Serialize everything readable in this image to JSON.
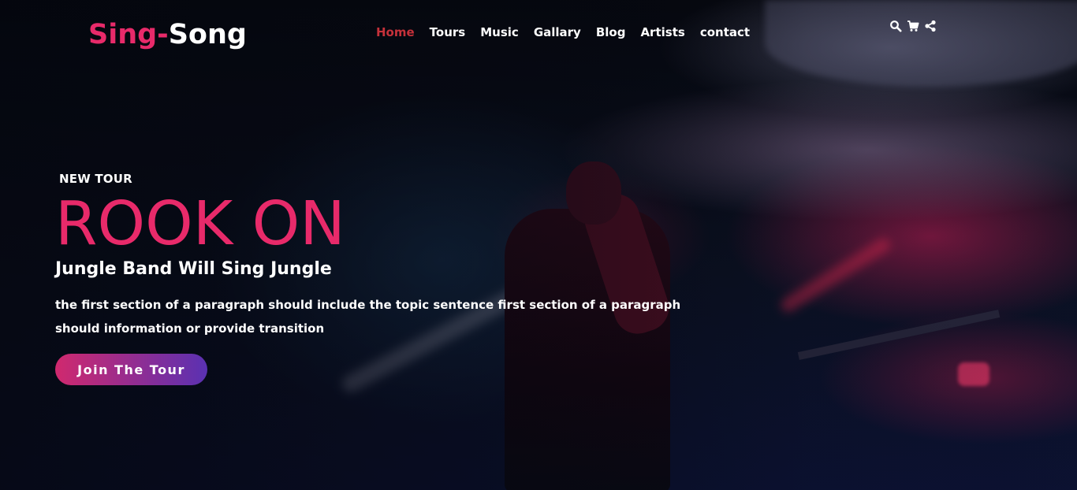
{
  "brand": {
    "part1": "Sing-",
    "part2": "Song",
    "accent": "#e82a6a"
  },
  "nav": {
    "items": [
      {
        "label": "Home",
        "active": true
      },
      {
        "label": "Tours",
        "active": false
      },
      {
        "label": "Music",
        "active": false
      },
      {
        "label": "Gallary",
        "active": false
      },
      {
        "label": "Blog",
        "active": false
      },
      {
        "label": "Artists",
        "active": false
      },
      {
        "label": "contact",
        "active": false
      }
    ],
    "active_color": "#c5313a"
  },
  "tools": {
    "icons": [
      "search-icon",
      "cart-icon",
      "share-icon"
    ]
  },
  "hero": {
    "eyebrow": "NEW TOUR",
    "headline": "ROOK ON",
    "subhead": "Jungle Band Will Sing Jungle",
    "paragraph": "the first section of a paragraph should include the topic sentence first section of a paragraph should information or provide transition",
    "cta_label": "Join The Tour",
    "cta_gradient": [
      "#d0296e",
      "#5a31b2"
    ]
  }
}
